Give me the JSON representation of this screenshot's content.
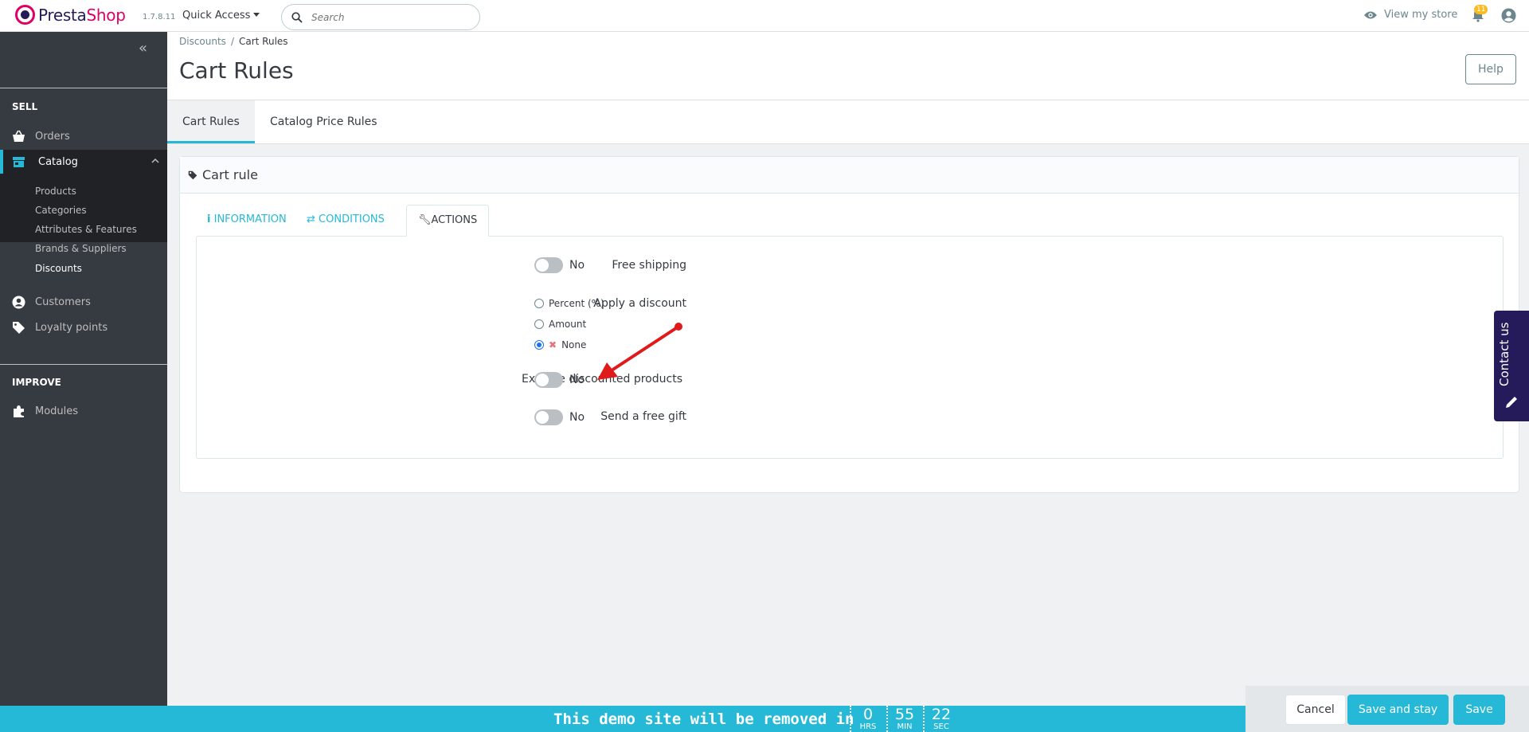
{
  "header": {
    "logo_presta": "Presta",
    "logo_shop": "Shop",
    "version": "1.7.8.11",
    "quick_access": "Quick Access",
    "search_placeholder": "Search",
    "view_store": "View my store",
    "notifications_count": "11"
  },
  "sidebar": {
    "sections": [
      {
        "title": "SELL"
      },
      {
        "title": "IMPROVE"
      }
    ],
    "items": [
      {
        "label": "Orders",
        "icon": "basket-icon"
      },
      {
        "label": "Catalog",
        "icon": "store-icon"
      },
      {
        "label": "Customers",
        "icon": "user-icon"
      },
      {
        "label": "Loyalty points",
        "icon": "tag-icon"
      },
      {
        "label": "Modules",
        "icon": "puzzle-icon"
      }
    ],
    "catalog_sub": [
      "Products",
      "Categories",
      "Attributes & Features",
      "Brands & Suppliers",
      "Discounts"
    ]
  },
  "breadcrumb": {
    "parent": "Discounts",
    "separator": "/",
    "current": "Cart Rules"
  },
  "page_title": "Cart Rules",
  "help_label": "Help",
  "page_tabs": [
    "Cart Rules",
    "Catalog Price Rules"
  ],
  "panel": {
    "title": "Cart rule",
    "tabs": [
      "INFORMATION",
      "CONDITIONS",
      "ACTIONS"
    ],
    "fields": {
      "free_shipping": {
        "label": "Free shipping",
        "value": "No"
      },
      "apply_discount": {
        "label": "Apply a discount",
        "options": [
          "Percent (%)",
          "Amount",
          "None"
        ],
        "selected": "None"
      },
      "exclude_discounted": {
        "label": "Exclude discounted products",
        "value": "No"
      },
      "free_gift": {
        "label": "Send a free gift",
        "value": "No"
      }
    }
  },
  "contact_us": "Contact us",
  "demo": {
    "text": "This demo site will be removed in",
    "hrs": "0",
    "hrs_label": "HRS",
    "min": "55",
    "min_label": "MIN",
    "sec": "22",
    "sec_label": "SEC"
  },
  "actions": {
    "cancel": "Cancel",
    "save_stay": "Save and stay",
    "save": "Save"
  },
  "colors": {
    "accent": "#25b9d7",
    "sidebar": "#363a41",
    "brand_pink": "#df0067",
    "brand_navy": "#251b5b",
    "annotation_arrow": "#e0191b"
  }
}
